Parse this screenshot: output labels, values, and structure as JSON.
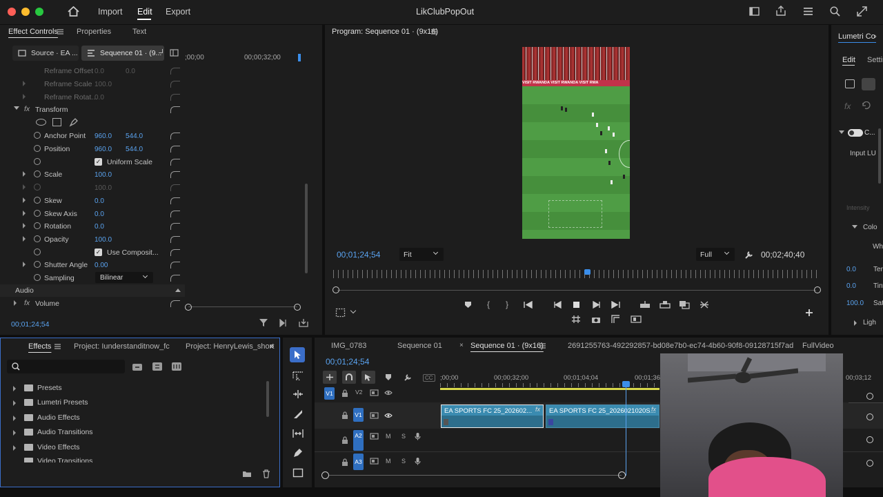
{
  "window": {
    "title": "LikClubPopOut"
  },
  "menu": {
    "import": "Import",
    "edit": "Edit",
    "export": "Export"
  },
  "effect_controls": {
    "tabs": {
      "effect_controls": "Effect Controls",
      "properties": "Properties",
      "text": "Text"
    },
    "source_tab": "Source · EA ...",
    "sequence_tab": "Sequence 01 · (9...",
    "ruler": {
      "t1": ";00;00",
      "t2": "00;00;32;00"
    },
    "rows": {
      "reframe_offset": {
        "label": "Reframe Offset",
        "v1": "0.0",
        "v2": "0.0"
      },
      "reframe_scale": {
        "label": "Reframe Scale",
        "v1": "100.0"
      },
      "reframe_rotat": {
        "label": "Reframe Rotat...",
        "v1": "0.0"
      },
      "transform": {
        "label": "Transform"
      },
      "anchor_point": {
        "label": "Anchor Point",
        "v1": "960.0",
        "v2": "544.0"
      },
      "position": {
        "label": "Position",
        "v1": "960.0",
        "v2": "544.0"
      },
      "uniform_scale": {
        "label": "Uniform Scale"
      },
      "scale": {
        "label": "Scale",
        "v1": "100.0"
      },
      "scale_width": {
        "v1": "100.0"
      },
      "skew": {
        "label": "Skew",
        "v1": "0.0"
      },
      "skew_axis": {
        "label": "Skew Axis",
        "v1": "0.0"
      },
      "rotation": {
        "label": "Rotation",
        "v1": "0.0"
      },
      "opacity": {
        "label": "Opacity",
        "v1": "100.0"
      },
      "use_composite": {
        "label": "Use Composit..."
      },
      "shutter_angle": {
        "label": "Shutter Angle",
        "v1": "0.00"
      },
      "sampling": {
        "label": "Sampling",
        "v1": "Bilinear"
      }
    },
    "audio_label": "Audio",
    "volume_label": "Volume",
    "timecode": "00;01;24;54"
  },
  "program": {
    "title": "Program: Sequence 01 · (9x16)",
    "timecode": "00;01;24;54",
    "fit": "Fit",
    "quality": "Full",
    "duration": "00;02;40;40",
    "banner": "VISIT RWANDA   VISIT RWANDA   VISIT RWA"
  },
  "lumetri": {
    "title": "Lumetri Co",
    "edit_tab": "Edit",
    "settings_tab": "Settin",
    "input": "Input LU",
    "intensity": "Intensity",
    "color": "Colo",
    "white": "Whi",
    "temp_val": "0.0",
    "temp": "Tem",
    "tint_val": "0.0",
    "tint": "Tint",
    "sat_val": "100.0",
    "sat": "Satu",
    "light": "Ligh"
  },
  "effects": {
    "tabs": {
      "effects": "Effects",
      "project1": "Project: Iunderstanditnow_fc",
      "project2": "Project: HenryLewis_short"
    },
    "search_placeholder": "",
    "items": [
      "Presets",
      "Lumetri Presets",
      "Audio Effects",
      "Audio Transitions",
      "Video Effects",
      "Video Transitions"
    ]
  },
  "timeline": {
    "tabs": [
      "IMG_0783",
      "Sequence 01",
      "Sequence 01 · (9x16)",
      "2691255763-492292857-bd08e7b0-ec74-4b60-90f8-09128715f7ad",
      "FullVideo"
    ],
    "timecode": "00;01;24;54",
    "ruler": {
      "t1": ";00;00",
      "t2": "00;00;32;00",
      "t3": "00;01;04;04",
      "t4": "00;01;36",
      "t5": "00;03;12"
    },
    "tracks": {
      "v1_src": "V1",
      "v2": "V2",
      "v1": "V1",
      "a2": "A2",
      "a3": "A3",
      "m": "M",
      "s": "S"
    },
    "clips": {
      "c1": "EA SPORTS FC 25_202602...",
      "c2": "EA SPORTS FC 25_2026021020S..."
    }
  }
}
